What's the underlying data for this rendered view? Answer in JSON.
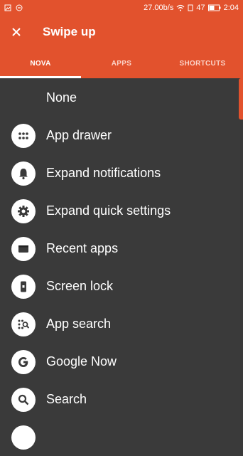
{
  "status_bar": {
    "speed": "27.00b/s",
    "battery_percent": "47",
    "time": "2:04"
  },
  "app_bar": {
    "title": "Swipe up"
  },
  "tabs": [
    {
      "label": "NOVA",
      "active": true
    },
    {
      "label": "APPS",
      "active": false
    },
    {
      "label": "SHORTCUTS",
      "active": false
    }
  ],
  "items": [
    {
      "label": "None",
      "icon": ""
    },
    {
      "label": "App drawer",
      "icon": "app-drawer-icon"
    },
    {
      "label": "Expand notifications",
      "icon": "bell-icon"
    },
    {
      "label": "Expand quick settings",
      "icon": "gear-icon"
    },
    {
      "label": "Recent apps",
      "icon": "recent-apps-icon"
    },
    {
      "label": "Screen lock",
      "icon": "phone-lock-icon"
    },
    {
      "label": "App search",
      "icon": "app-search-icon"
    },
    {
      "label": "Google Now",
      "icon": "google-icon"
    },
    {
      "label": "Search",
      "icon": "search-icon"
    }
  ],
  "colors": {
    "accent": "#e2522d",
    "background": "#3a3a3a"
  }
}
